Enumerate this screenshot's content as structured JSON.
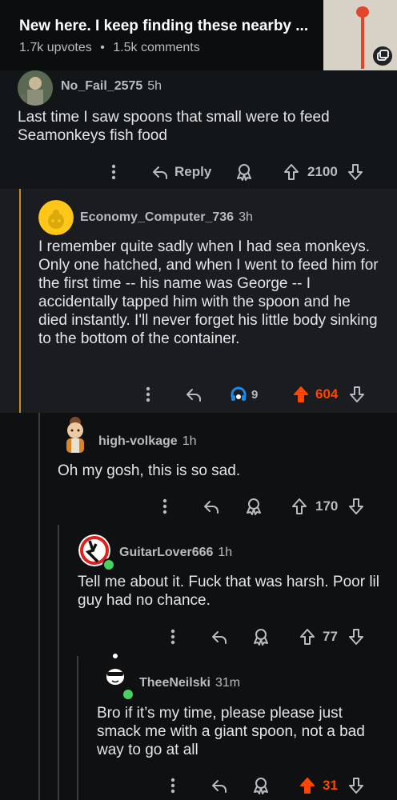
{
  "post": {
    "title": "New here. I keep finding these nearby ...",
    "upvotes": "1.7k upvotes",
    "separator": "•",
    "comments": "1.5k comments"
  },
  "icons": {
    "more": "more-vertical-icon",
    "reply": "reply-arrow-icon",
    "award": "award-icon",
    "upvote": "upvote-arrow-icon",
    "downvote": "downvote-arrow-icon"
  },
  "colors": {
    "background": "#0b0d0f",
    "accent": "#ff4500",
    "thread_gold": "#c58b23",
    "online": "#46d160"
  },
  "comments": [
    {
      "author": "No_Fail_2575",
      "age": "5h",
      "body": "Last time I saw spoons that small were to feed Seamonkeys fish food",
      "reply_label": "Reply",
      "score": "2100"
    },
    {
      "author": "Economy_Computer_736",
      "age": "3h",
      "body": "I remember quite sadly when I had sea monkeys. Only one hatched, and when I went to feed him for the first time -- his name was George -- I accidentally tapped him with the spoon and he died instantly. I'll never forget his little body sinking to the bottom of the container.",
      "award_count": "9",
      "score": "604"
    },
    {
      "author": "high-volkage",
      "age": "1h",
      "body": "Oh my gosh, this is so sad.",
      "score": "170"
    },
    {
      "author": "GuitarLover666",
      "age": "1h",
      "body": "Tell me about it. Fuck that was harsh. Poor lil guy had no chance.",
      "score": "77"
    },
    {
      "author": "TheeNeilski",
      "age": "31m",
      "body": "Bro if it’s my time, please please just smack me with a giant spoon, not a bad way to go at all",
      "score": "31"
    }
  ]
}
